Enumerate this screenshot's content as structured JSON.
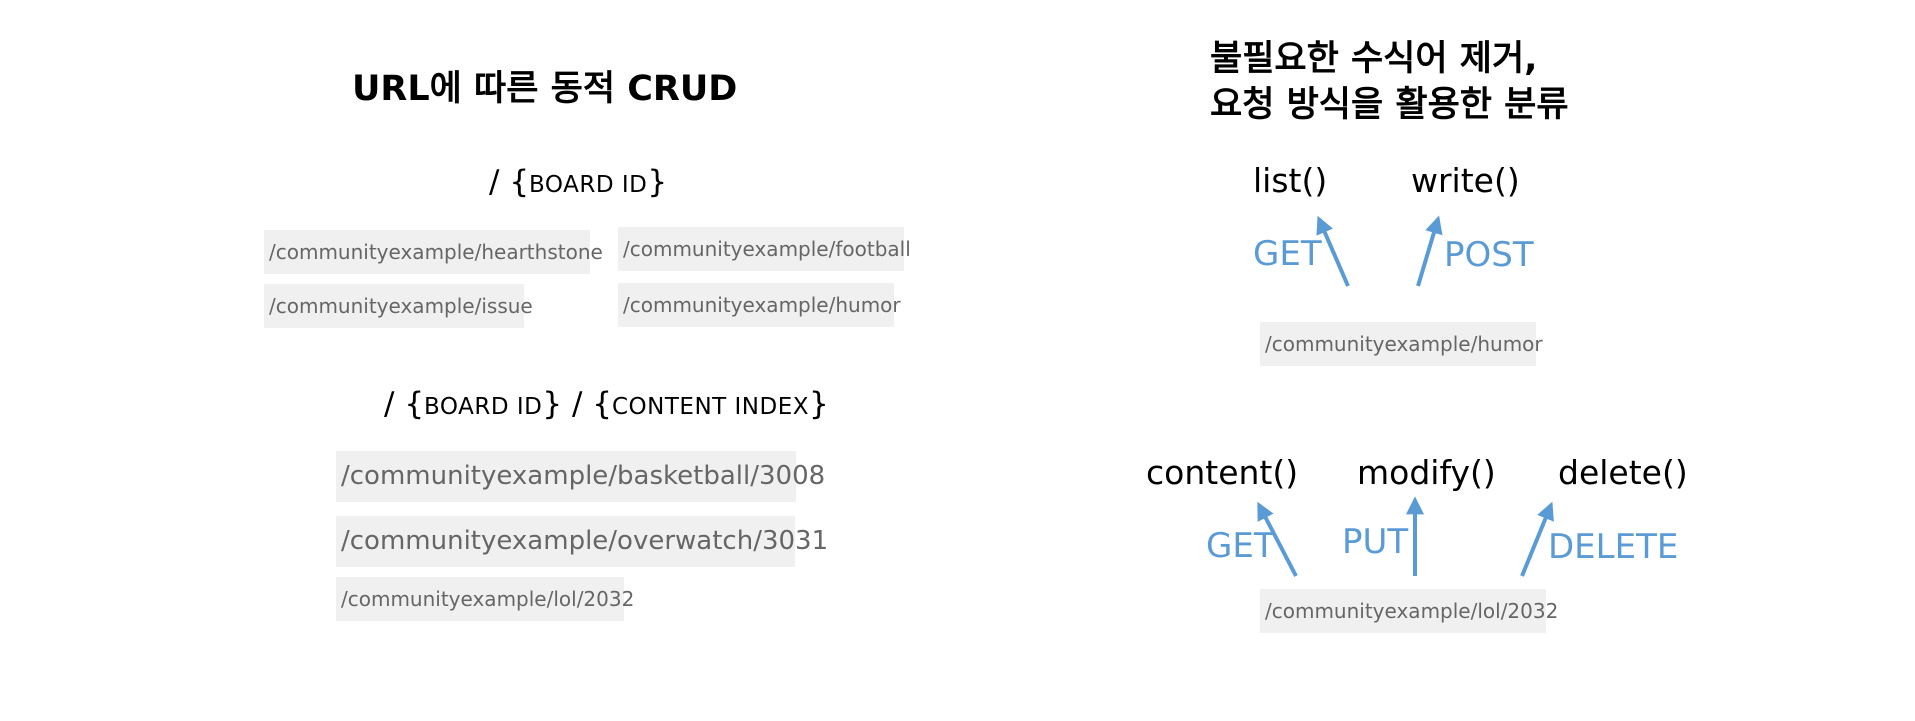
{
  "left": {
    "title": "URL에 따른 동적 CRUD",
    "pattern1": {
      "slash": "/",
      "open": "{",
      "label": "BOARD ID",
      "close": "}"
    },
    "pattern1_urls": [
      "/communityexample/hearthstone",
      "/communityexample/football",
      "/communityexample/issue",
      "/communityexample/humor"
    ],
    "pattern2": {
      "slash1": "/",
      "open1": "{",
      "label1": "BOARD ID",
      "close1": "}",
      "slash2": "/",
      "open2": "{",
      "label2": "CONTENT INDEX",
      "close2": "}"
    },
    "pattern2_urls": [
      "/communityexample/basketball/3008",
      "/communityexample/overwatch/3031",
      "/communityexample/lol/2032"
    ]
  },
  "right": {
    "title_line1": "불필요한 수식어 제거,",
    "title_line2": "요청 방식을 활용한 분류",
    "group1": {
      "functions": [
        "list()",
        "write()"
      ],
      "methods": [
        "GET",
        "POST"
      ],
      "url": "/communityexample/humor"
    },
    "group2": {
      "functions": [
        "content()",
        "modify()",
        "delete()"
      ],
      "methods": [
        "GET",
        "PUT",
        "DELETE"
      ],
      "url": "/communityexample/lol/2032"
    }
  },
  "colors": {
    "accent": "#5b9bd5",
    "chip_background": "#f0f0f0",
    "chip_text": "#666666"
  }
}
